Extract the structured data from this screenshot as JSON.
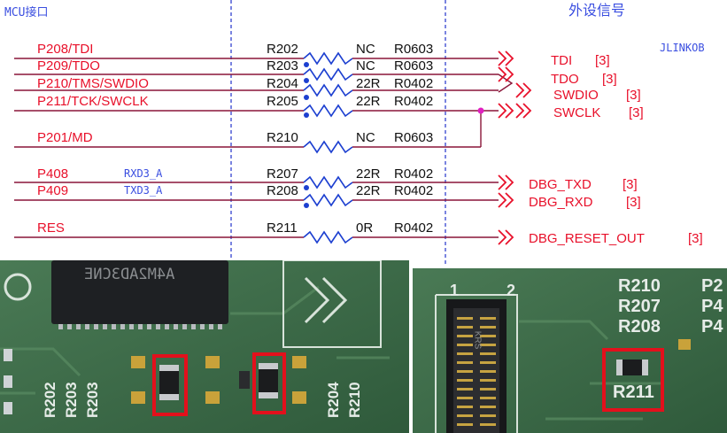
{
  "headers": {
    "mcu": "MCU接口",
    "external": "外设信号",
    "jlink": "JLINKOB"
  },
  "nets": [
    {
      "pin": "P208/TDI",
      "ref": "R202",
      "value": "NC",
      "pkg": "R0603"
    },
    {
      "pin": "P209/TDO",
      "ref": "R203",
      "value": "NC",
      "pkg": "R0603"
    },
    {
      "pin": "P210/TMS/SWDIO",
      "ref": "R204",
      "value": "22R",
      "pkg": "R0402"
    },
    {
      "pin": "P211/TCK/SWCLK",
      "ref": "R205",
      "value": "22R",
      "pkg": "R0402"
    },
    {
      "pin": "P201/MD",
      "ref": "R210",
      "value": "NC",
      "pkg": "R0603"
    },
    {
      "pin": "P408",
      "ref": "R207",
      "value": "22R",
      "pkg": "R0402",
      "alias": "RXD3_A"
    },
    {
      "pin": "P409",
      "ref": "R208",
      "value": "22R",
      "pkg": "R0402",
      "alias": "TXD3_A"
    },
    {
      "pin": "RES",
      "ref": "R211",
      "value": "0R",
      "pkg": "R0402"
    }
  ],
  "signals": [
    {
      "name": "TDI",
      "sheet": "[3]"
    },
    {
      "name": "TDO",
      "sheet": "[3]"
    },
    {
      "name": "SWDIO",
      "sheet": "[3]"
    },
    {
      "name": "SWCLK",
      "sheet": "[3]"
    },
    {
      "name": "DBG_TXD",
      "sheet": "[3]"
    },
    {
      "name": "DBG_RXD",
      "sheet": "[3]"
    },
    {
      "name": "DBG_RESET_OUT",
      "sheet": "[3]"
    }
  ],
  "photo_left": {
    "chip_marking": "A4M2AD3CNE",
    "silk_left": [
      "R202",
      "R203",
      "R203"
    ],
    "silk_right": [
      "R204",
      "R210"
    ]
  },
  "photo_right": {
    "silk_numbers": [
      "1",
      "2"
    ],
    "silk_refs": [
      "R210",
      "R207",
      "R208"
    ],
    "silk_partial": [
      "P2",
      "P4",
      "P4"
    ],
    "highlight_label": "R211",
    "connector_marking": "KRS"
  },
  "colors": {
    "wire": "#8a1538",
    "resistor": "#1c3fd0",
    "pin_text": "#e8102a",
    "alias_text": "#3a4ee0",
    "divider": "#2233cc",
    "junction": "#e020c0",
    "highlight": "#e3101c",
    "pcb": "#3d6b49"
  }
}
